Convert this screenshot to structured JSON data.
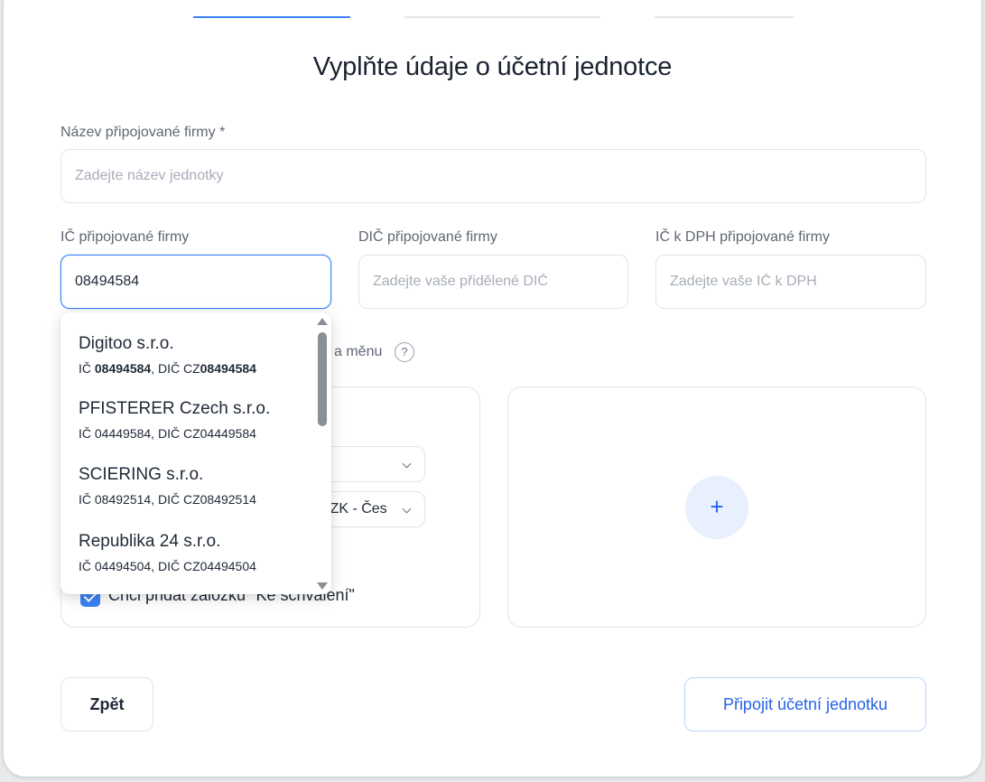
{
  "stepper": [
    "step-1",
    "step-2",
    "step-3"
  ],
  "title": "Vyplňte údaje o účetní jednotce",
  "company_name": {
    "label": "Název připojované firmy *",
    "placeholder": "Zadejte název jednotky",
    "value": ""
  },
  "ic": {
    "label": "IČ připojované firmy",
    "value": "08494584"
  },
  "dic": {
    "label": "DIČ připojované firmy",
    "placeholder": "Zadejte vaše přidělené DIČ"
  },
  "ic_dph": {
    "label": "IČ k DPH připojované firmy",
    "placeholder": "Zadejte vaše IČ k DPH"
  },
  "currency_section": {
    "hint_partial": "a měnu",
    "help_icon": "question-circle-icon",
    "currency_select_value": "CZK - Čes"
  },
  "checkbox": {
    "label_partial": "Chci přidat záložku \"Ke schválení\"",
    "checked": true
  },
  "add_button_symbol": "+",
  "suggestions": [
    {
      "name": "Digitoo s.r.o.",
      "ic_prefix": "IČ ",
      "ic": "08494584",
      "dic_prefix": ", DIČ CZ",
      "dic": "08494584"
    },
    {
      "name": "PFISTERER Czech s.r.o.",
      "ids": "IČ 04449584, DIČ CZ04449584"
    },
    {
      "name": "SCIERING s.r.o.",
      "ids": "IČ 08492514, DIČ CZ08492514"
    },
    {
      "name": "Republika 24 s.r.o.",
      "ids": "IČ 04494504, DIČ CZ04494504"
    }
  ],
  "buttons": {
    "back": "Zpět",
    "connect": "Připojit účetní jednotku"
  },
  "colors": {
    "accent": "#3b82f6",
    "primary_text": "#2563eb"
  }
}
